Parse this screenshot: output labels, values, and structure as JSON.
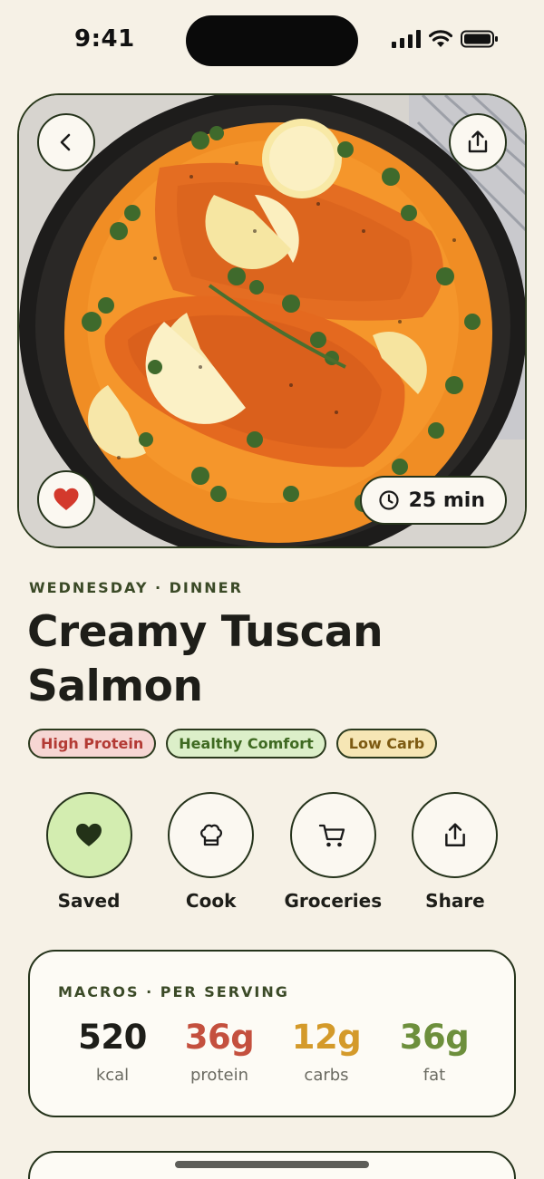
{
  "status_bar": {
    "time": "9:41"
  },
  "hero": {
    "cook_time": "25 min",
    "icons": {
      "back": "chevron-left-icon",
      "share": "share-icon",
      "favorite": "heart-icon",
      "clock": "clock-icon"
    }
  },
  "recipe": {
    "meal_label": "WEDNESDAY · DINNER",
    "title": "Creamy Tuscan Salmon",
    "tags": [
      {
        "label": "High Protein",
        "color": "#b33a34"
      },
      {
        "label": "Healthy Comfort",
        "color": "#3f6a22"
      },
      {
        "label": "Low Carb",
        "color": "#7d5a12"
      }
    ]
  },
  "actions": [
    {
      "label": "Saved",
      "icon": "heart-icon",
      "active": true
    },
    {
      "label": "Cook",
      "icon": "chef-hat-icon"
    },
    {
      "label": "Groceries",
      "icon": "cart-icon"
    },
    {
      "label": "Share",
      "icon": "share-icon"
    }
  ],
  "macros": {
    "title": "MACROS · PER SERVING",
    "items": [
      {
        "value": "520",
        "unit": "kcal",
        "color": "#1e1e19"
      },
      {
        "value": "36g",
        "unit": "protein",
        "color": "#c4503e"
      },
      {
        "value": "12g",
        "unit": "carbs",
        "color": "#d49a2a"
      },
      {
        "value": "36g",
        "unit": "fat",
        "color": "#6d8f3c"
      }
    ]
  }
}
